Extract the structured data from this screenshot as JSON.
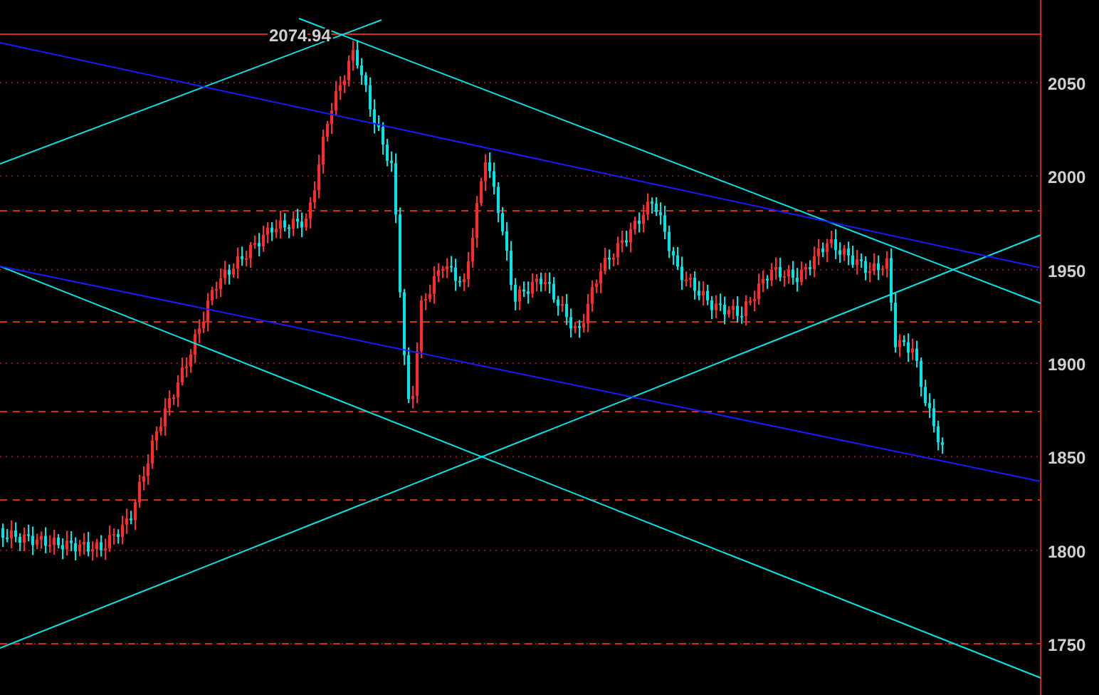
{
  "chart": {
    "price_label": "2074.94",
    "y_axis_labels": [
      "2050",
      "2000",
      "1950",
      "1900",
      "1850",
      "1800",
      "1750"
    ]
  }
}
